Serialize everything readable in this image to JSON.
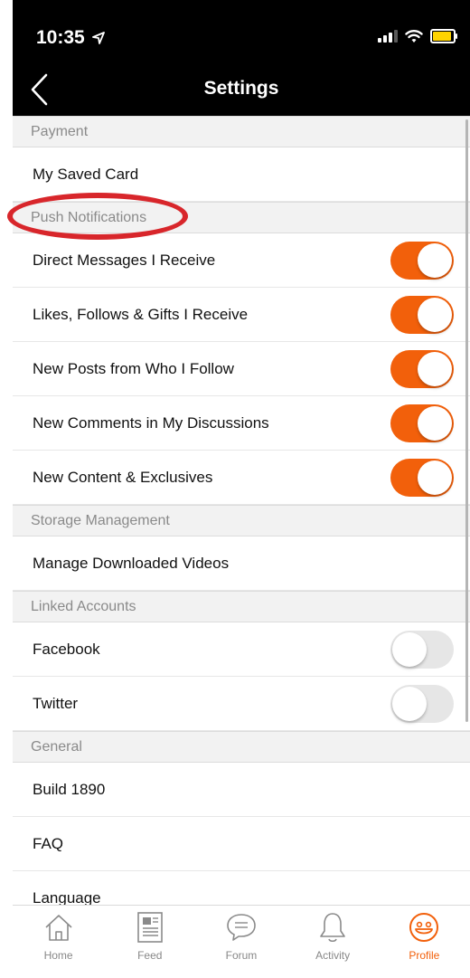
{
  "status_bar": {
    "time": "10:35"
  },
  "header": {
    "title": "Settings"
  },
  "sections": [
    {
      "title": "Payment",
      "rows": [
        {
          "label": "My Saved Card"
        }
      ]
    },
    {
      "title": "Push Notifications",
      "rows": [
        {
          "label": "Direct Messages I Receive",
          "toggle": true
        },
        {
          "label": "Likes, Follows & Gifts I Receive",
          "toggle": true
        },
        {
          "label": "New Posts from Who I Follow",
          "toggle": true
        },
        {
          "label": "New Comments in My Discussions",
          "toggle": true
        },
        {
          "label": "New Content & Exclusives",
          "toggle": true
        }
      ]
    },
    {
      "title": "Storage Management",
      "rows": [
        {
          "label": "Manage Downloaded Videos"
        }
      ]
    },
    {
      "title": "Linked Accounts",
      "rows": [
        {
          "label": "Facebook",
          "toggle": false
        },
        {
          "label": "Twitter",
          "toggle": false
        }
      ]
    },
    {
      "title": "General",
      "rows": [
        {
          "label": "Build 1890"
        },
        {
          "label": "FAQ"
        },
        {
          "label": "Language"
        }
      ]
    }
  ],
  "tabs": [
    {
      "label": "Home",
      "icon": "home-icon"
    },
    {
      "label": "Feed",
      "icon": "feed-icon"
    },
    {
      "label": "Forum",
      "icon": "forum-icon"
    },
    {
      "label": "Activity",
      "icon": "bell-icon"
    },
    {
      "label": "Profile",
      "icon": "smiley-icon",
      "active": true
    }
  ],
  "colors": {
    "accent": "#f2600b",
    "toggle_off": "#e6e6e6",
    "annotation": "#d8262b"
  }
}
